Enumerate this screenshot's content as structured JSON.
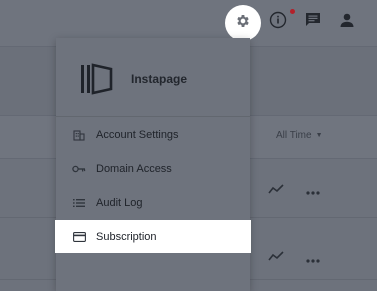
{
  "header": {
    "icons": [
      "gear-icon",
      "info-icon",
      "chat-icon",
      "person-icon"
    ],
    "notification_color": "#b3202a"
  },
  "table": {
    "filter_label": "All Time",
    "row_actions": [
      "trend-icon",
      "more-icon"
    ]
  },
  "dropdown": {
    "brand_name": "Instapage",
    "items": [
      {
        "label": "Account Settings",
        "icon": "building-icon"
      },
      {
        "label": "Domain Access",
        "icon": "key-icon"
      },
      {
        "label": "Audit Log",
        "icon": "list-icon"
      },
      {
        "label": "Subscription",
        "icon": "credit-card-icon",
        "active": true
      }
    ]
  }
}
